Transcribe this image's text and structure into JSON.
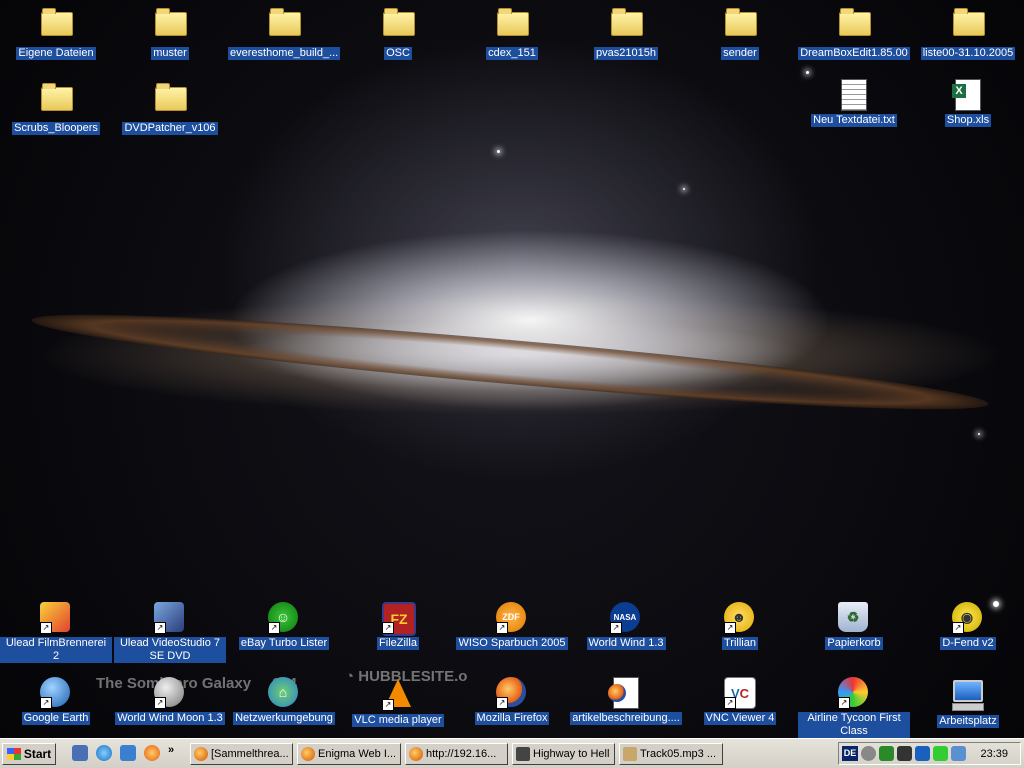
{
  "desktop": {
    "wallpaper_caption": "The Sombrero Galaxy",
    "wallpaper_number": "104",
    "wallpaper_brand": "HUBBLESITE.o",
    "icons": [
      {
        "label": "Eigene Dateien",
        "icon": "my-documents-folder-icon"
      },
      {
        "label": "muster",
        "icon": "folder-icon"
      },
      {
        "label": "everesthome_build_...",
        "icon": "folder-icon"
      },
      {
        "label": "OSC",
        "icon": "folder-icon"
      },
      {
        "label": "cdex_151",
        "icon": "folder-icon"
      },
      {
        "label": "pvas21015h",
        "icon": "folder-icon"
      },
      {
        "label": "sender",
        "icon": "folder-icon"
      },
      {
        "label": "DreamBoxEdit1.85.00",
        "icon": "folder-icon"
      },
      {
        "label": "liste00-31.10.2005",
        "icon": "folder-icon"
      },
      {
        "label": "Scrubs_Bloopers",
        "icon": "folder-icon"
      },
      {
        "label": "DVDPatcher_v106",
        "icon": "folder-icon"
      },
      {
        "label": "Neu Textdatei.txt",
        "icon": "text-file-icon"
      },
      {
        "label": "Shop.xls",
        "icon": "excel-file-icon"
      },
      {
        "label": "Ulead FilmBrennerei 2",
        "icon": "ulead-filmbrennerei-icon"
      },
      {
        "label": "Ulead VideoStudio 7 SE DVD",
        "icon": "ulead-videostudio-icon"
      },
      {
        "label": "eBay Turbo Lister",
        "icon": "ebay-turbo-lister-icon"
      },
      {
        "label": "FileZilla",
        "icon": "filezilla-icon"
      },
      {
        "label": "WISO Sparbuch 2005",
        "icon": "wiso-sparbuch-icon"
      },
      {
        "label": "World Wind 1.3",
        "icon": "nasa-world-wind-icon"
      },
      {
        "label": "Trillian",
        "icon": "trillian-icon"
      },
      {
        "label": "Papierkorb",
        "icon": "recycle-bin-icon"
      },
      {
        "label": "D-Fend v2",
        "icon": "d-fend-icon"
      },
      {
        "label": "Google Earth",
        "icon": "google-earth-icon"
      },
      {
        "label": "World Wind Moon 1.3",
        "icon": "world-wind-moon-icon"
      },
      {
        "label": "Netzwerkumgebung",
        "icon": "network-places-icon"
      },
      {
        "label": "VLC media player",
        "icon": "vlc-icon"
      },
      {
        "label": "Mozilla Firefox",
        "icon": "firefox-icon"
      },
      {
        "label": "artikelbeschreibung....",
        "icon": "firefox-html-file-icon"
      },
      {
        "label": "VNC Viewer 4",
        "icon": "vnc-viewer-icon"
      },
      {
        "label": "Airline Tycoon First Class",
        "icon": "airline-tycoon-icon"
      },
      {
        "label": "Arbeitsplatz",
        "icon": "my-computer-icon"
      }
    ]
  },
  "taskbar": {
    "start_label": "Start",
    "quicklaunch_more": "»",
    "tasks": [
      {
        "label": "[Sammelthrea...",
        "icon": "firefox-icon"
      },
      {
        "label": "Enigma Web I...",
        "icon": "firefox-icon"
      },
      {
        "label": "http://192.16...",
        "icon": "firefox-icon"
      },
      {
        "label": "Highway to Hell",
        "icon": "winamp-icon"
      },
      {
        "label": "Track05.mp3 ...",
        "icon": "audio-icon"
      }
    ],
    "tray": {
      "language": "DE",
      "clock": "23:39"
    }
  }
}
